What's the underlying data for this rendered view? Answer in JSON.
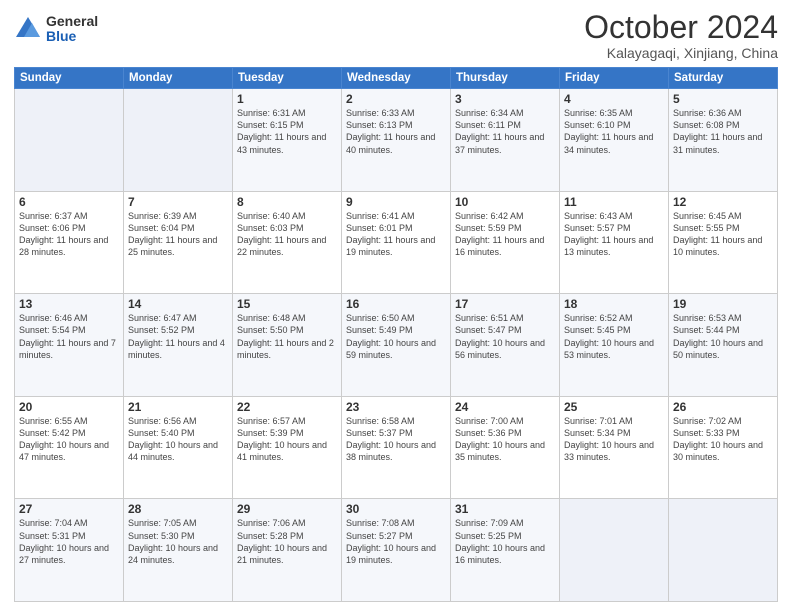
{
  "header": {
    "logo_general": "General",
    "logo_blue": "Blue",
    "month_title": "October 2024",
    "subtitle": "Kalayagaqi, Xinjiang, China"
  },
  "weekdays": [
    "Sunday",
    "Monday",
    "Tuesday",
    "Wednesday",
    "Thursday",
    "Friday",
    "Saturday"
  ],
  "weeks": [
    [
      {
        "day": "",
        "info": ""
      },
      {
        "day": "",
        "info": ""
      },
      {
        "day": "1",
        "info": "Sunrise: 6:31 AM\nSunset: 6:15 PM\nDaylight: 11 hours and 43 minutes."
      },
      {
        "day": "2",
        "info": "Sunrise: 6:33 AM\nSunset: 6:13 PM\nDaylight: 11 hours and 40 minutes."
      },
      {
        "day": "3",
        "info": "Sunrise: 6:34 AM\nSunset: 6:11 PM\nDaylight: 11 hours and 37 minutes."
      },
      {
        "day": "4",
        "info": "Sunrise: 6:35 AM\nSunset: 6:10 PM\nDaylight: 11 hours and 34 minutes."
      },
      {
        "day": "5",
        "info": "Sunrise: 6:36 AM\nSunset: 6:08 PM\nDaylight: 11 hours and 31 minutes."
      }
    ],
    [
      {
        "day": "6",
        "info": "Sunrise: 6:37 AM\nSunset: 6:06 PM\nDaylight: 11 hours and 28 minutes."
      },
      {
        "day": "7",
        "info": "Sunrise: 6:39 AM\nSunset: 6:04 PM\nDaylight: 11 hours and 25 minutes."
      },
      {
        "day": "8",
        "info": "Sunrise: 6:40 AM\nSunset: 6:03 PM\nDaylight: 11 hours and 22 minutes."
      },
      {
        "day": "9",
        "info": "Sunrise: 6:41 AM\nSunset: 6:01 PM\nDaylight: 11 hours and 19 minutes."
      },
      {
        "day": "10",
        "info": "Sunrise: 6:42 AM\nSunset: 5:59 PM\nDaylight: 11 hours and 16 minutes."
      },
      {
        "day": "11",
        "info": "Sunrise: 6:43 AM\nSunset: 5:57 PM\nDaylight: 11 hours and 13 minutes."
      },
      {
        "day": "12",
        "info": "Sunrise: 6:45 AM\nSunset: 5:55 PM\nDaylight: 11 hours and 10 minutes."
      }
    ],
    [
      {
        "day": "13",
        "info": "Sunrise: 6:46 AM\nSunset: 5:54 PM\nDaylight: 11 hours and 7 minutes."
      },
      {
        "day": "14",
        "info": "Sunrise: 6:47 AM\nSunset: 5:52 PM\nDaylight: 11 hours and 4 minutes."
      },
      {
        "day": "15",
        "info": "Sunrise: 6:48 AM\nSunset: 5:50 PM\nDaylight: 11 hours and 2 minutes."
      },
      {
        "day": "16",
        "info": "Sunrise: 6:50 AM\nSunset: 5:49 PM\nDaylight: 10 hours and 59 minutes."
      },
      {
        "day": "17",
        "info": "Sunrise: 6:51 AM\nSunset: 5:47 PM\nDaylight: 10 hours and 56 minutes."
      },
      {
        "day": "18",
        "info": "Sunrise: 6:52 AM\nSunset: 5:45 PM\nDaylight: 10 hours and 53 minutes."
      },
      {
        "day": "19",
        "info": "Sunrise: 6:53 AM\nSunset: 5:44 PM\nDaylight: 10 hours and 50 minutes."
      }
    ],
    [
      {
        "day": "20",
        "info": "Sunrise: 6:55 AM\nSunset: 5:42 PM\nDaylight: 10 hours and 47 minutes."
      },
      {
        "day": "21",
        "info": "Sunrise: 6:56 AM\nSunset: 5:40 PM\nDaylight: 10 hours and 44 minutes."
      },
      {
        "day": "22",
        "info": "Sunrise: 6:57 AM\nSunset: 5:39 PM\nDaylight: 10 hours and 41 minutes."
      },
      {
        "day": "23",
        "info": "Sunrise: 6:58 AM\nSunset: 5:37 PM\nDaylight: 10 hours and 38 minutes."
      },
      {
        "day": "24",
        "info": "Sunrise: 7:00 AM\nSunset: 5:36 PM\nDaylight: 10 hours and 35 minutes."
      },
      {
        "day": "25",
        "info": "Sunrise: 7:01 AM\nSunset: 5:34 PM\nDaylight: 10 hours and 33 minutes."
      },
      {
        "day": "26",
        "info": "Sunrise: 7:02 AM\nSunset: 5:33 PM\nDaylight: 10 hours and 30 minutes."
      }
    ],
    [
      {
        "day": "27",
        "info": "Sunrise: 7:04 AM\nSunset: 5:31 PM\nDaylight: 10 hours and 27 minutes."
      },
      {
        "day": "28",
        "info": "Sunrise: 7:05 AM\nSunset: 5:30 PM\nDaylight: 10 hours and 24 minutes."
      },
      {
        "day": "29",
        "info": "Sunrise: 7:06 AM\nSunset: 5:28 PM\nDaylight: 10 hours and 21 minutes."
      },
      {
        "day": "30",
        "info": "Sunrise: 7:08 AM\nSunset: 5:27 PM\nDaylight: 10 hours and 19 minutes."
      },
      {
        "day": "31",
        "info": "Sunrise: 7:09 AM\nSunset: 5:25 PM\nDaylight: 10 hours and 16 minutes."
      },
      {
        "day": "",
        "info": ""
      },
      {
        "day": "",
        "info": ""
      }
    ]
  ]
}
